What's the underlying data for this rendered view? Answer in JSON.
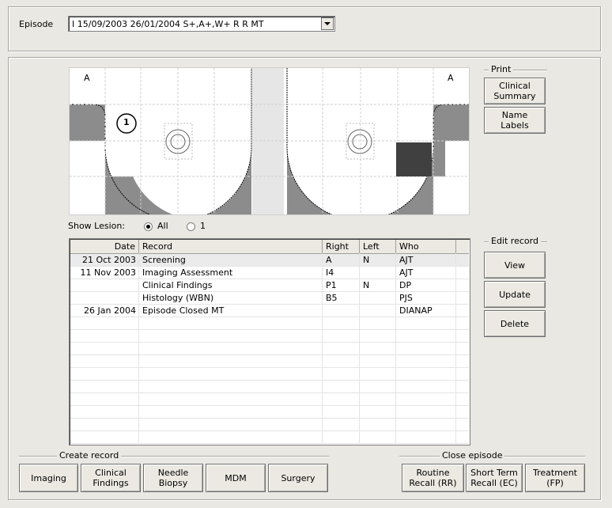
{
  "episode": {
    "label": "Episode",
    "value": "I 15/09/2003 26/01/2004 S+,A+,W+ R R MT"
  },
  "diagram": {
    "left_marker": "A",
    "right_marker": "A",
    "lesion_number": "1"
  },
  "print": {
    "group_label": "Print",
    "clinical_summary": "Clinical\nSummary",
    "name_labels": "Name\nLabels"
  },
  "show_lesion": {
    "label": "Show Lesion:",
    "option_all": "All",
    "option_1": "1",
    "selected": "All"
  },
  "records": {
    "columns": [
      "Date",
      "Record",
      "Right",
      "Left",
      "Who"
    ],
    "rows": [
      {
        "date": "21 Oct 2003",
        "record": "Screening",
        "right": "A",
        "left": "N",
        "who": "AJT"
      },
      {
        "date": "11 Nov 2003",
        "record": "Imaging Assessment",
        "right": "I4",
        "left": "",
        "who": "AJT"
      },
      {
        "date": "",
        "record": "Clinical Findings",
        "right": "P1",
        "left": "N",
        "who": "DP"
      },
      {
        "date": "",
        "record": "Histology (WBN)",
        "right": "B5",
        "left": "",
        "who": "PJS"
      },
      {
        "date": "26 Jan 2004",
        "record": "Episode Closed MT",
        "right": "",
        "left": "",
        "who": "DIANAP"
      }
    ]
  },
  "edit_record": {
    "group_label": "Edit record",
    "view": "View",
    "update": "Update",
    "delete": "Delete"
  },
  "create_record": {
    "group_label": "Create record",
    "buttons": [
      "Imaging",
      "Clinical\nFindings",
      "Needle\nBiopsy",
      "MDM",
      "Surgery"
    ]
  },
  "close_episode": {
    "group_label": "Close episode",
    "buttons": [
      "Routine\nRecall (RR)",
      "Short Term\nRecall (EC)",
      "Treatment\n(FP)"
    ]
  },
  "colors": {
    "tissue_grey": "#8c8c8c",
    "lesion_dark": "#404040",
    "selected_row": "#ebebeb"
  }
}
